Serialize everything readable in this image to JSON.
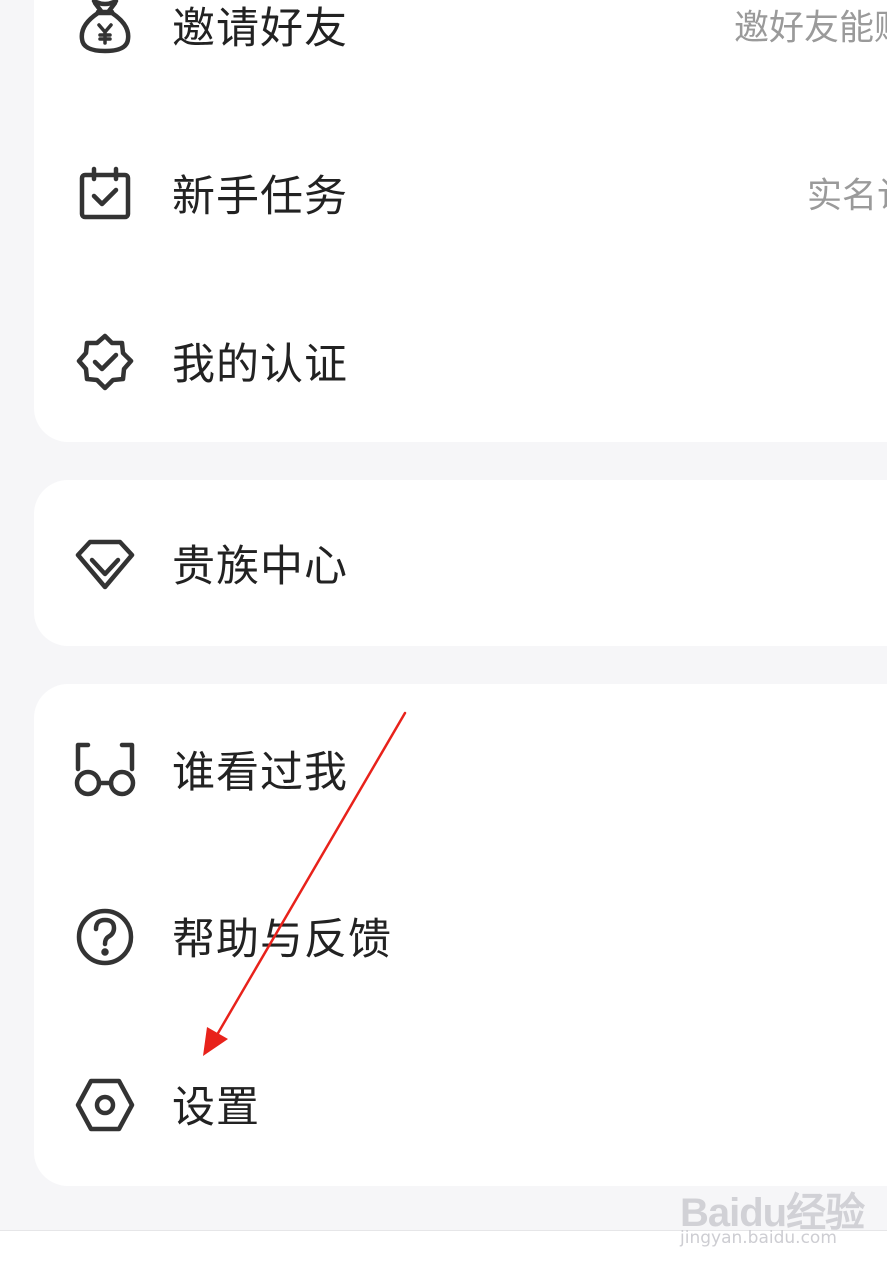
{
  "sections": [
    {
      "items": [
        {
          "label": "邀请好友",
          "hint": "邀好友能赚",
          "icon": "money-bag-icon"
        },
        {
          "label": "新手任务",
          "hint": "实名认",
          "icon": "calendar-check-icon"
        },
        {
          "label": "我的认证",
          "hint": "",
          "icon": "verified-badge-icon"
        }
      ]
    },
    {
      "items": [
        {
          "label": "贵族中心",
          "hint": "",
          "icon": "diamond-icon"
        }
      ]
    },
    {
      "items": [
        {
          "label": "谁看过我",
          "hint": "",
          "icon": "glasses-icon"
        },
        {
          "label": "帮助与反馈",
          "hint": "",
          "icon": "help-circle-icon"
        },
        {
          "label": "设置",
          "hint": "",
          "icon": "settings-hexagon-icon"
        }
      ]
    }
  ],
  "watermark": {
    "logo": "Baidu经验",
    "url": "jingyan.baidu.com"
  },
  "colors": {
    "background": "#f6f6f8",
    "card": "#ffffff",
    "text": "#222222",
    "hint": "#9a9a9a",
    "icon_stroke": "#333333",
    "annotation_arrow": "#e8221b"
  }
}
